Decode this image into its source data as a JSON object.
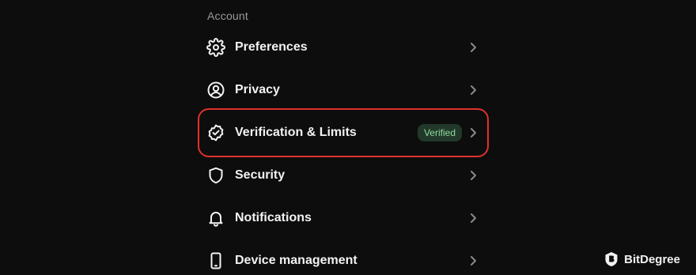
{
  "section": {
    "title": "Account"
  },
  "menu": {
    "items": [
      {
        "label": "Preferences",
        "icon": "gear-icon"
      },
      {
        "label": "Privacy",
        "icon": "user-circle-icon"
      },
      {
        "label": "Verification & Limits",
        "icon": "verified-badge-icon",
        "badge": "Verified",
        "highlighted": true
      },
      {
        "label": "Security",
        "icon": "shield-icon"
      },
      {
        "label": "Notifications",
        "icon": "bell-icon"
      },
      {
        "label": "Device management",
        "icon": "phone-icon"
      }
    ]
  },
  "watermark": {
    "brand": "BitDegree"
  },
  "colors": {
    "background": "#0d0d0d",
    "highlight_outline": "#e0312b",
    "badge_bg": "#22382a",
    "badge_text": "#8fd9a0"
  }
}
